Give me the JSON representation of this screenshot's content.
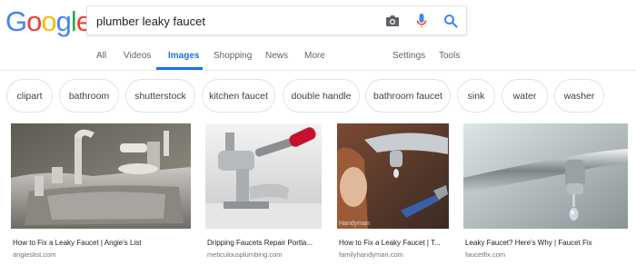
{
  "logo": {
    "letters": [
      "G",
      "o",
      "o",
      "g",
      "l",
      "e"
    ],
    "colors": [
      "#4285F4",
      "#EA4335",
      "#FBBC05",
      "#4285F4",
      "#34A853",
      "#EA4335"
    ]
  },
  "search": {
    "query": "plumber leaky faucet"
  },
  "icons": {
    "camera": "camera-icon",
    "mic": "mic-icon",
    "search": "search-icon"
  },
  "tabs": {
    "all": "All",
    "videos": "Videos",
    "images": "Images",
    "shopping": "Shopping",
    "news": "News",
    "more": "More",
    "settings": "Settings",
    "tools": "Tools"
  },
  "chips": [
    "clipart",
    "bathroom",
    "shutterstock",
    "kitchen faucet",
    "double handle",
    "bathroom faucet",
    "sink",
    "water",
    "washer"
  ],
  "results": [
    {
      "title": "How to Fix a Leaky Faucet | Angie's List",
      "source": "angieslist.com"
    },
    {
      "title": "Dripping Faucets Repair Portla...",
      "source": "meticulousplumbing.com"
    },
    {
      "title": "How to Fix a Leaky Faucet | T...",
      "source": "familyhandyman.com",
      "watermark": "Handyman"
    },
    {
      "title": "Leaky Faucet? Here's Why | Faucet Fix",
      "source": "faucetfix.com"
    }
  ],
  "colors": {
    "accent": "#1a73e8",
    "mic_red": "#EA4335",
    "mic_blue": "#4285F4"
  }
}
